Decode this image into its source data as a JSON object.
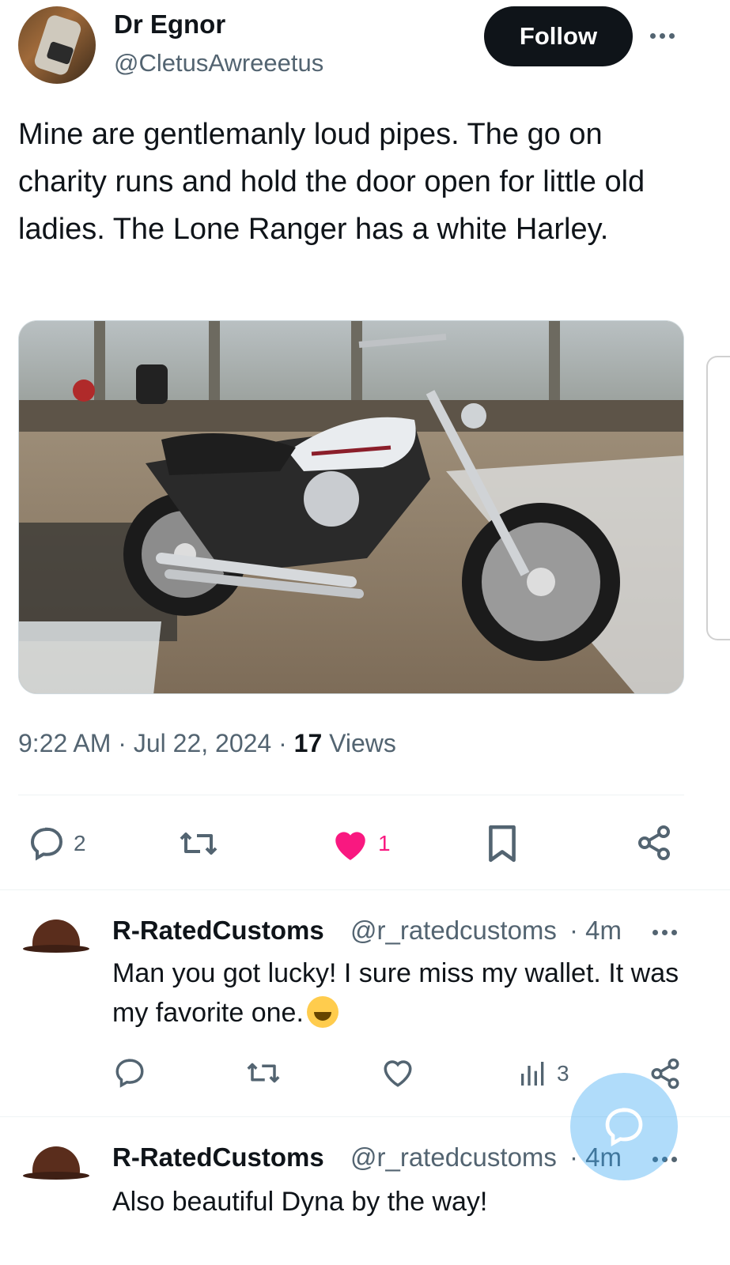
{
  "author": {
    "name": "Dr Egnor",
    "handle": "@CletusAwreeetus",
    "follow_label": "Follow"
  },
  "tweet": {
    "text": "Mine are gentlemanly loud pipes. The go on charity runs and hold the door open for little old ladies.  The Lone Ranger has a white Harley.",
    "time": "9:22 AM",
    "date": "Jul 22, 2024",
    "views_count": "17",
    "views_label": "Views",
    "replies": "2",
    "likes": "1"
  },
  "replies": [
    {
      "name": "R-RatedCustoms",
      "handle": "@r_ratedcustoms",
      "time": "4m",
      "text": "Man you got lucky! I sure miss my wallet. It was my favorite one.",
      "views": "3"
    },
    {
      "name": "R-RatedCustoms",
      "handle": "@r_ratedcustoms",
      "time": "4m",
      "text": "Also beautiful Dyna by the way!"
    }
  ],
  "colors": {
    "text_primary": "#0f1419",
    "text_secondary": "#536471",
    "like_pink": "#f91880",
    "fab_blue": "#1d9bf0"
  },
  "icons": [
    "more-icon",
    "reply-icon",
    "repost-icon",
    "like-icon",
    "bookmark-icon",
    "share-icon",
    "views-icon",
    "compose-icon"
  ]
}
